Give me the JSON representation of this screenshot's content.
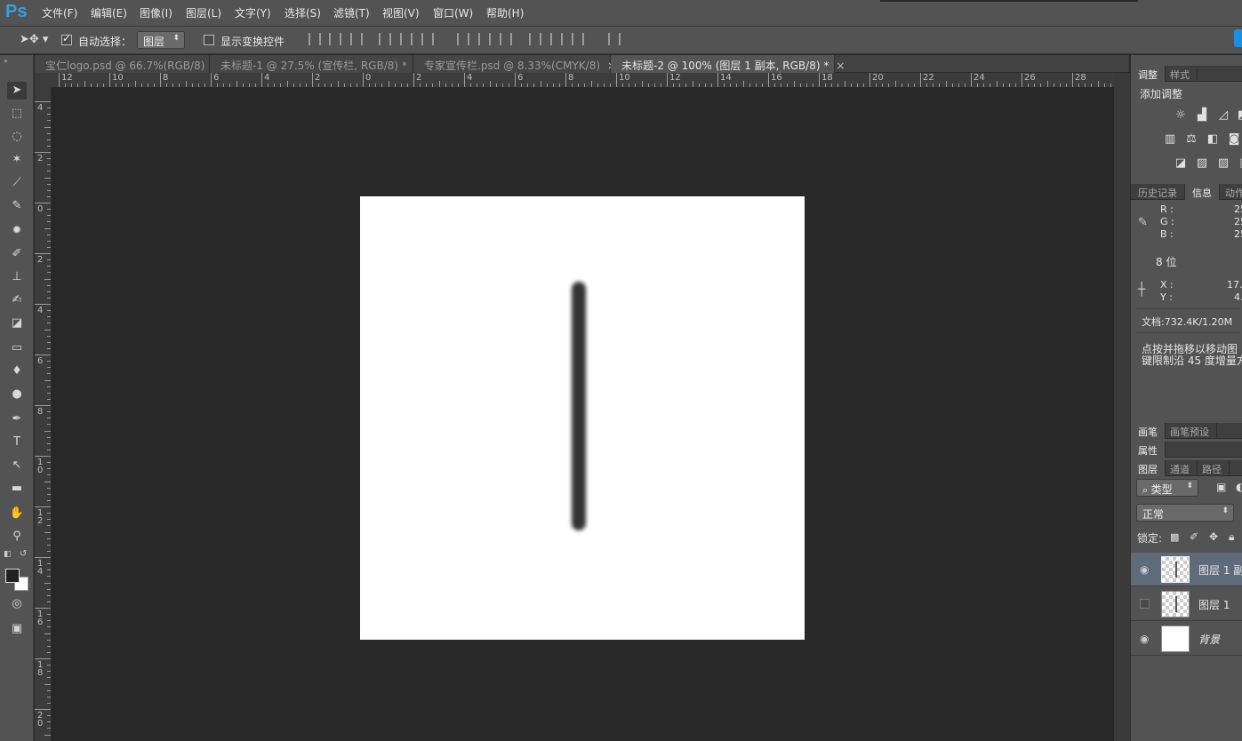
{
  "app": {
    "logo": "Ps"
  },
  "menu": [
    "文件(F)",
    "编辑(E)",
    "图像(I)",
    "图层(L)",
    "文字(Y)",
    "选择(S)",
    "滤镜(T)",
    "视图(V)",
    "窗口(W)",
    "帮助(H)"
  ],
  "options": {
    "auto_select_label": "自动选择：",
    "auto_select_value": "图层",
    "show_transform_label": "显示变换控件"
  },
  "tabs": [
    {
      "label": "宝仁logo.psd @ 66.7%(RGB/8)",
      "close": "×"
    },
    {
      "label": "未标题-1 @ 27.5% (宣传栏, RGB/8) *",
      "close": "×"
    },
    {
      "label": "专家宣传栏.psd @ 8.33%(CMYK/8)",
      "close": "×"
    },
    {
      "label": "未标题-2 @ 100% (图层 1 副本, RGB/8) *",
      "close": "×"
    }
  ],
  "ruler_h": [
    "12",
    "10",
    "8",
    "6",
    "4",
    "2",
    "0",
    "2",
    "4",
    "6",
    "8",
    "10",
    "12",
    "14",
    "16",
    "18",
    "20",
    "22",
    "24",
    "26",
    "28"
  ],
  "ruler_v": [
    "4",
    "2",
    "0",
    "2",
    "4",
    "6",
    "8",
    "1\n0",
    "1\n2",
    "1\n4",
    "1\n6",
    "1\n8",
    "2\n0"
  ],
  "panels": {
    "adjust_tabs": [
      "调整",
      "样式"
    ],
    "adjust_title": "添加调整",
    "info_tabs": [
      "历史记录",
      "信息",
      "动作"
    ],
    "info": {
      "r_label": "R :",
      "g_label": "G :",
      "b_label": "B :",
      "r_val": "25",
      "g_val": "25",
      "b_val": "25",
      "bits": "8 位",
      "x_label": "X :",
      "y_label": "Y :",
      "x_val": "17.",
      "y_val": "4.",
      "doc": "文档:732.4K/1.20M",
      "hint1": "点按并拖移以移动图",
      "hint2": "键限制沿 45 度增量方"
    },
    "brush_tabs": [
      "画笔",
      "画笔预设"
    ],
    "props_tab": "属性",
    "layer_tabs": [
      "图层",
      "通道",
      "路径"
    ],
    "kind_label": "类型",
    "blend_mode": "正常",
    "lock_label": "锁定:",
    "layers": [
      {
        "name": "图层 1 副",
        "visible": true,
        "selected": true
      },
      {
        "name": "图层 1",
        "visible": false,
        "selected": false
      },
      {
        "name": "背景",
        "visible": true,
        "selected": false
      }
    ]
  }
}
